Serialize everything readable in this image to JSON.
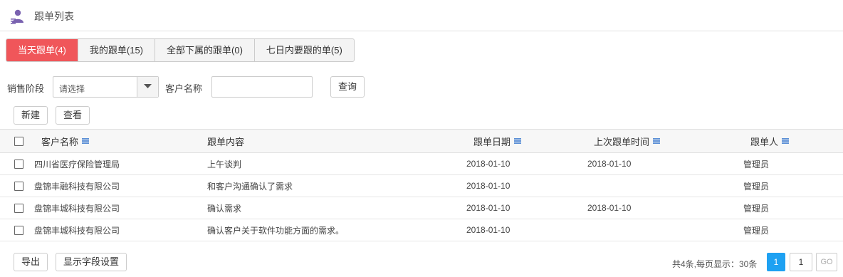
{
  "header": {
    "title": "跟单列表",
    "icon": "user-list-icon",
    "icon_color": "#7a62b0"
  },
  "tabs": [
    {
      "label": "当天跟单(4)",
      "active": true
    },
    {
      "label": "我的跟单(15)",
      "active": false
    },
    {
      "label": "全部下属的跟单(0)",
      "active": false
    },
    {
      "label": "七日内要跟的单(5)",
      "active": false
    }
  ],
  "filters": {
    "stage_label": "销售阶段",
    "stage_value": "请选择",
    "customer_label": "客户名称",
    "customer_value": "",
    "search_button": "查询"
  },
  "toolbar": {
    "new_button": "新建",
    "view_button": "查看"
  },
  "table": {
    "columns": [
      "客户名称",
      "跟单内容",
      "跟单日期",
      "上次跟单时间",
      "跟单人"
    ],
    "rows": [
      [
        "四川省医疗保险管理局",
        "上午谈判",
        "2018-01-10",
        "2018-01-10",
        "管理员"
      ],
      [
        "盘锦丰融科技有限公司",
        "和客户沟通确认了需求",
        "2018-01-10",
        "",
        "管理员"
      ],
      [
        "盘锦丰城科技有限公司",
        "确认需求",
        "2018-01-10",
        "2018-01-10",
        "管理员"
      ],
      [
        "盘锦丰城科技有限公司",
        "确认客户关于软件功能方面的需求。",
        "2018-01-10",
        "",
        "管理员"
      ]
    ]
  },
  "footer": {
    "export_button": "导出",
    "fields_button": "显示字段设置",
    "pager_info": "共4条,每页显示：30条",
    "current_page": "1",
    "page_input": "1",
    "go_button": "GO"
  },
  "colors": {
    "active_tab": "#f0565a",
    "pager_active": "#1ea1f2",
    "sort_icon": "#5b8fd6"
  }
}
